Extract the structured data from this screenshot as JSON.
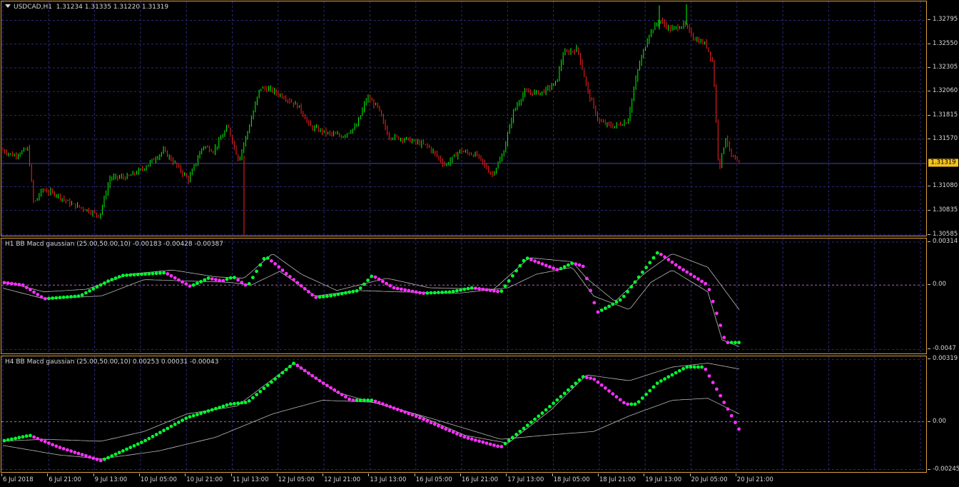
{
  "main": {
    "title": "USDCAD,H1  1.31234 1.31335 1.31220 1.31319",
    "current_price_label": "1.31319",
    "current_price": 1.31319,
    "price_ticks": [
      "1.32795",
      "1.32550",
      "1.32305",
      "1.32060",
      "1.31815",
      "1.31570",
      "1.31080",
      "1.30835",
      "1.30585"
    ],
    "price_tick_values": [
      1.32795,
      1.3255,
      1.32305,
      1.3206,
      1.31815,
      1.3157,
      1.3108,
      1.30835,
      1.30585
    ],
    "price_range": [
      1.3056,
      1.3299
    ],
    "bull_color": "#00ff00",
    "bear_color": "#ff2020"
  },
  "h1": {
    "title": "H1 BB Macd gaussian (25.00,50.00,10) -0.00183 -0.00428 -0.00387",
    "ticks": [
      "0.00314",
      "0.00",
      "-0.0047"
    ],
    "tick_values": [
      0.00314,
      0.0,
      -0.0047
    ],
    "range": [
      -0.0051,
      0.0034
    ]
  },
  "h4": {
    "title": "H4 BB Macd gaussian (25.00,50.00,10) 0.00253 0.00031 -0.00043",
    "ticks": [
      "0.00319",
      "0.00",
      "-0.00245"
    ],
    "tick_values": [
      0.00319,
      0.0,
      -0.00245
    ],
    "range": [
      -0.00265,
      0.00335
    ]
  },
  "time_axis": {
    "labels": [
      "6 Jul 2018",
      "6 Jul 21:00",
      "9 Jul 13:00",
      "10 Jul 05:00",
      "10 Jul 21:00",
      "11 Jul 13:00",
      "12 Jul 05:00",
      "12 Jul 21:00",
      "13 Jul 13:00",
      "16 Jul 05:00",
      "16 Jul 21:00",
      "17 Jul 13:00",
      "18 Jul 05:00",
      "18 Jul 21:00",
      "19 Jul 13:00",
      "20 Jul 05:00",
      "20 Jul 21:00"
    ]
  },
  "colors": {
    "background": "#000000",
    "frame": "#d8a040",
    "grid": "#2a2a80",
    "zero_line": "#b060c0",
    "dot_up": "#00ff30",
    "dot_down": "#ff30ff",
    "band": "#b8b8b8",
    "price_label_bg": "#f0c020"
  }
}
